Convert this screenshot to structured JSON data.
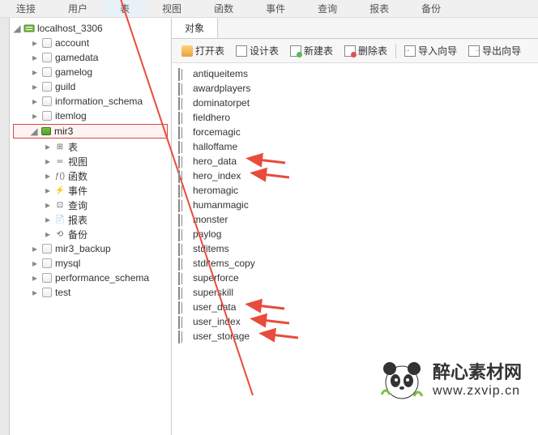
{
  "menu": [
    "连接",
    "用户",
    "表",
    "视图",
    "函数",
    "事件",
    "查询",
    "报表",
    "备份"
  ],
  "tree": {
    "root": "localhost_3306",
    "dbs": [
      "account",
      "gamedata",
      "gamelog",
      "guild",
      "information_schema",
      "itemlog"
    ],
    "selected": "mir3",
    "sub": [
      "表",
      "视图",
      "函数",
      "事件",
      "查询",
      "报表",
      "备份"
    ],
    "after": [
      "mir3_backup",
      "mysql",
      "performance_schema",
      "test"
    ]
  },
  "tab": "对象",
  "toolbar": {
    "open": "打开表",
    "design": "设计表",
    "new": "新建表",
    "del": "删除表",
    "imp": "导入向导",
    "exp": "导出向导"
  },
  "tables": [
    "antiqueitems",
    "awardplayers",
    "dominatorpet",
    "fieldhero",
    "forcemagic",
    "halloffame",
    "hero_data",
    "hero_index",
    "heromagic",
    "humanmagic",
    "monster",
    "paylog",
    "stditems",
    "stditems_copy",
    "superforce",
    "superskill",
    "user_data",
    "user_index",
    "user_storage"
  ],
  "watermark": {
    "name": "醉心素材网",
    "url": "www.zxvip.cn"
  }
}
